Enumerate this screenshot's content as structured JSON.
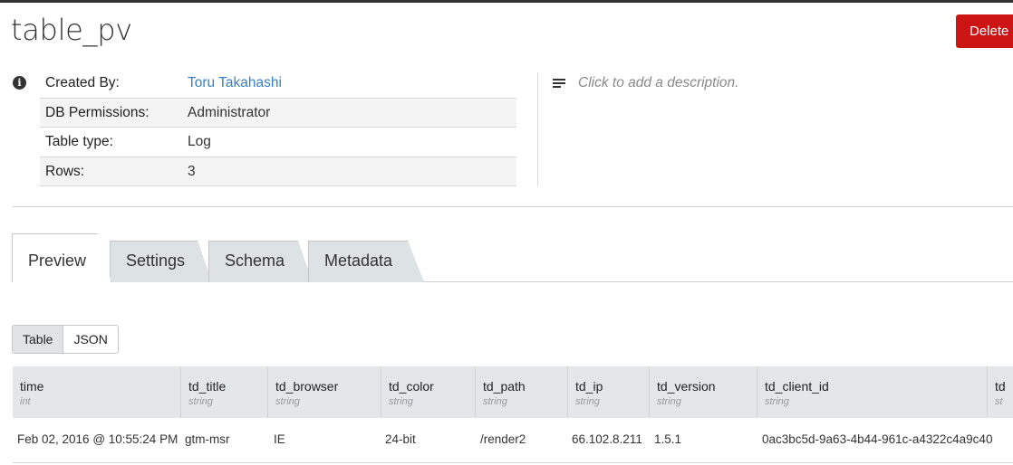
{
  "title": "table_pv",
  "delete_label": "Delete",
  "info": {
    "created_by_label": "Created By:",
    "created_by_value": "Toru Takahashi",
    "db_permissions_label": "DB Permissions:",
    "db_permissions_value": "Administrator",
    "table_type_label": "Table type:",
    "table_type_value": "Log",
    "rows_label": "Rows:",
    "rows_value": "3"
  },
  "description_placeholder": "Click to add a description.",
  "tabs": [
    {
      "label": "Preview",
      "active": true
    },
    {
      "label": "Settings",
      "active": false
    },
    {
      "label": "Schema",
      "active": false
    },
    {
      "label": "Metadata",
      "active": false
    }
  ],
  "view_toggle": {
    "table_label": "Table",
    "json_label": "JSON",
    "selected": "Table"
  },
  "columns": [
    {
      "name": "time",
      "type": "int"
    },
    {
      "name": "td_title",
      "type": "string"
    },
    {
      "name": "td_browser",
      "type": "string"
    },
    {
      "name": "td_color",
      "type": "string"
    },
    {
      "name": "td_path",
      "type": "string"
    },
    {
      "name": "td_ip",
      "type": "string"
    },
    {
      "name": "td_version",
      "type": "string"
    },
    {
      "name": "td_client_id",
      "type": "string"
    },
    {
      "name": "td",
      "type": "st"
    }
  ],
  "rows": [
    [
      "Feb 02, 2016 @ 10:55:24 PM",
      "gtm-msr",
      "IE",
      "24-bit",
      "/render2",
      "66.102.8.211",
      "1.5.1",
      "0ac3bc5d-9a63-4b44-961c-a4322c4a9c40",
      ""
    ]
  ],
  "colors": {
    "accent_link": "#3a7fc1",
    "danger": "#cc1414",
    "header_bg": "#e3e7ea"
  },
  "icons": {
    "info": "info-circle-icon",
    "description": "text-lines-icon"
  }
}
